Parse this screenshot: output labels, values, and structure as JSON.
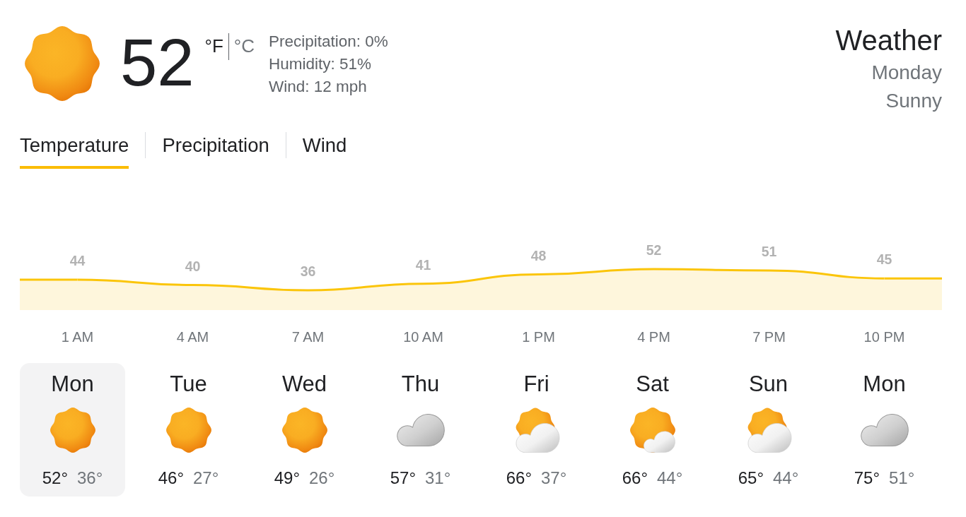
{
  "current": {
    "temperature": "52",
    "units": [
      {
        "label": "°F",
        "selected": true
      },
      {
        "label": "°C",
        "selected": false
      }
    ],
    "details": [
      "Precipitation: 0%",
      "Humidity: 51%",
      "Wind: 12 mph"
    ]
  },
  "summary": {
    "title": "Weather",
    "day": "Monday",
    "condition": "Sunny"
  },
  "tabs": [
    {
      "label": "Temperature",
      "selected": true
    },
    {
      "label": "Precipitation",
      "selected": false
    },
    {
      "label": "Wind",
      "selected": false
    }
  ],
  "hourly_chart": {
    "chart_data": {
      "type": "area",
      "categories": [
        "1 AM",
        "4 AM",
        "7 AM",
        "10 AM",
        "1 PM",
        "4 PM",
        "7 PM",
        "10 PM"
      ],
      "values": [
        44,
        40,
        36,
        41,
        48,
        52,
        51,
        45
      ],
      "data_labels": true
    }
  },
  "days": [
    {
      "name": "Mon",
      "kind": "sunny",
      "high": "52°",
      "low": "36°",
      "selected": true
    },
    {
      "name": "Tue",
      "kind": "sunny",
      "high": "46°",
      "low": "27°",
      "selected": false
    },
    {
      "name": "Wed",
      "kind": "sunny",
      "high": "49°",
      "low": "26°",
      "selected": false
    },
    {
      "name": "Thu",
      "kind": "cloudy",
      "high": "57°",
      "low": "31°",
      "selected": false
    },
    {
      "name": "Fri",
      "kind": "partlycloudy",
      "high": "66°",
      "low": "37°",
      "selected": false
    },
    {
      "name": "Sat",
      "kind": "mostlysunny",
      "high": "66°",
      "low": "44°",
      "selected": false
    },
    {
      "name": "Sun",
      "kind": "partlycloudy",
      "high": "65°",
      "low": "44°",
      "selected": false
    },
    {
      "name": "Mon",
      "kind": "cloudy",
      "high": "75°",
      "low": "51°",
      "selected": false
    }
  ]
}
